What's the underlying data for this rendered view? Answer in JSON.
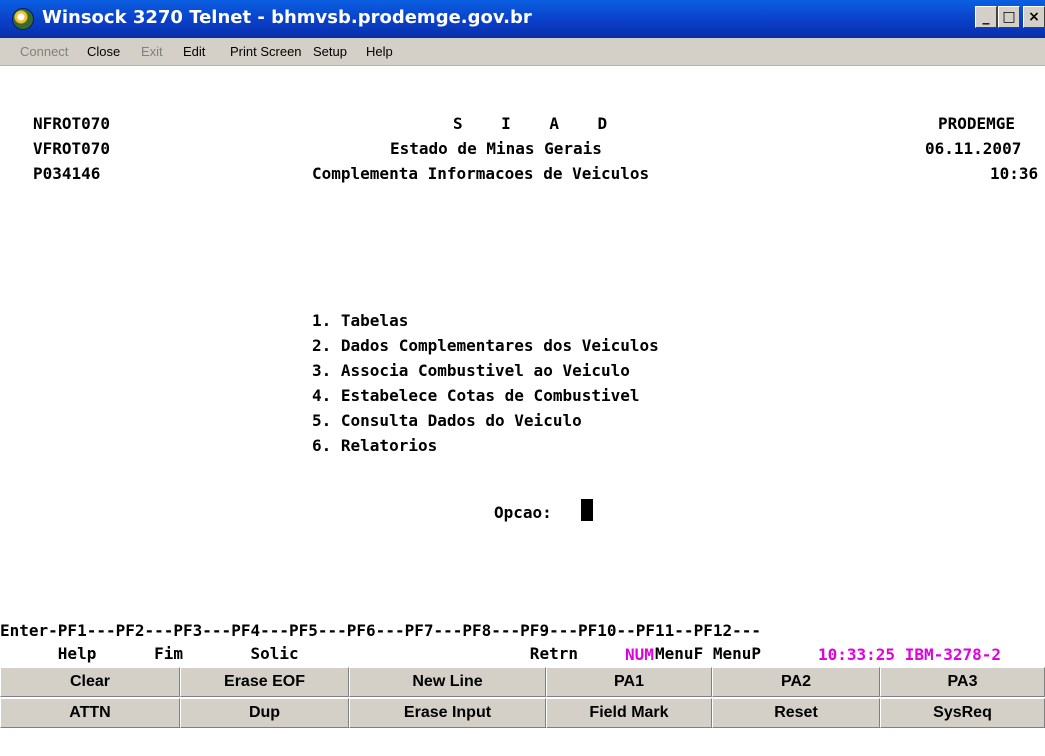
{
  "window": {
    "title": "Winsock 3270 Telnet - bhmvsb.prodemge.gov.br",
    "app_icon": "winsock-globe-icon",
    "controls": {
      "minimize": "_",
      "maximize": "□",
      "close": "×"
    }
  },
  "menu": {
    "items": [
      {
        "label": "Connect",
        "enabled": false
      },
      {
        "label": "Close",
        "enabled": true
      },
      {
        "label": "Exit",
        "enabled": false
      },
      {
        "label": "Edit",
        "enabled": true
      },
      {
        "label": "Print Screen",
        "enabled": true
      },
      {
        "label": "Setup",
        "enabled": true
      },
      {
        "label": "Help",
        "enabled": true
      }
    ]
  },
  "screen": {
    "header_left": [
      "NFROT070",
      "VFROT070",
      "P034146"
    ],
    "header_center": [
      "S    I    A    D",
      "Estado de Minas Gerais",
      "Complementa Informacoes de Veiculos"
    ],
    "header_right": [
      "PRODEMGE",
      "06.11.2007",
      "10:36"
    ],
    "options": [
      "1. Tabelas",
      "2. Dados Complementares dos Veiculos",
      "3. Associa Combustivel ao Veiculo",
      "4. Estabelece Cotas de Combustivel",
      "5. Consulta Dados do Veiculo",
      "6. Relatorios"
    ],
    "prompt": "Opcao:",
    "pf_line": "Enter-PF1---PF2---PF3---PF4---PF5---PF6---PF7---PF8---PF9---PF10--PF11--PF12---",
    "pf_labels": "      Help      Fim       Solic                        Retrn        MenuF MenuP",
    "status_num": "NUM",
    "status_time_model": "10:33:25 IBM-3278-2"
  },
  "keypad": {
    "row1": [
      "Clear",
      "Erase EOF",
      "New Line",
      "PA1",
      "PA2",
      "PA3"
    ],
    "row2": [
      "ATTN",
      "Dup",
      "Erase Input",
      "Field Mark",
      "Reset",
      "SysReq"
    ]
  },
  "colors": {
    "titlebar": "#0a3fc9",
    "status_text": "#e000e0",
    "panel": "#d4d0c8"
  }
}
